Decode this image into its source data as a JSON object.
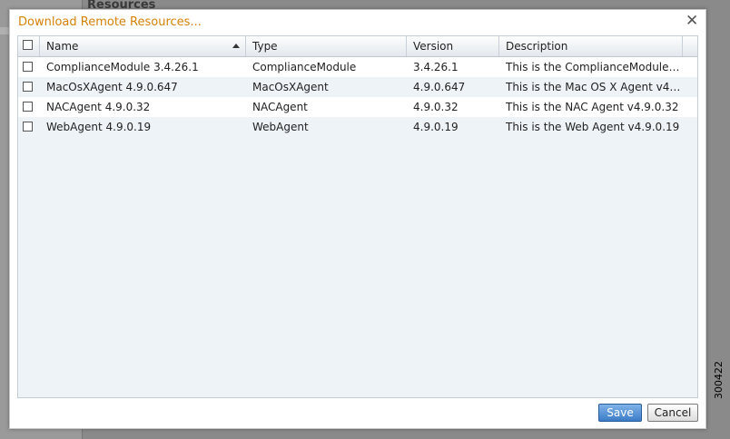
{
  "background": {
    "heading": "Resources"
  },
  "dialog": {
    "title": "Download Remote Resources...",
    "close_glyph": "✕"
  },
  "grid": {
    "columns": [
      "Name",
      "Type",
      "Version",
      "Description"
    ],
    "sort": {
      "column": "Name",
      "direction": "ascending"
    },
    "rows": [
      {
        "checked": false,
        "name": "ComplianceModule 3.4.26.1",
        "type": "ComplianceModule",
        "version": "3.4.26.1",
        "description": "This is the ComplianceModule v3..."
      },
      {
        "checked": false,
        "name": "MacOsXAgent 4.9.0.647",
        "type": "MacOsXAgent",
        "version": "4.9.0.647",
        "description": "This is the Mac OS X Agent v4.9..."
      },
      {
        "checked": false,
        "name": "NACAgent 4.9.0.32",
        "type": "NACAgent",
        "version": "4.9.0.32",
        "description": "This is the NAC Agent v4.9.0.32"
      },
      {
        "checked": false,
        "name": "WebAgent 4.9.0.19",
        "type": "WebAgent",
        "version": "4.9.0.19",
        "description": "This is the Web Agent v4.9.0.19"
      }
    ]
  },
  "buttons": {
    "save": "Save",
    "cancel": "Cancel"
  },
  "figure_id": "300422",
  "colors": {
    "title": "#d4820a",
    "save_button": "#3c7cc8",
    "grid_bg": "#eef3f8"
  }
}
